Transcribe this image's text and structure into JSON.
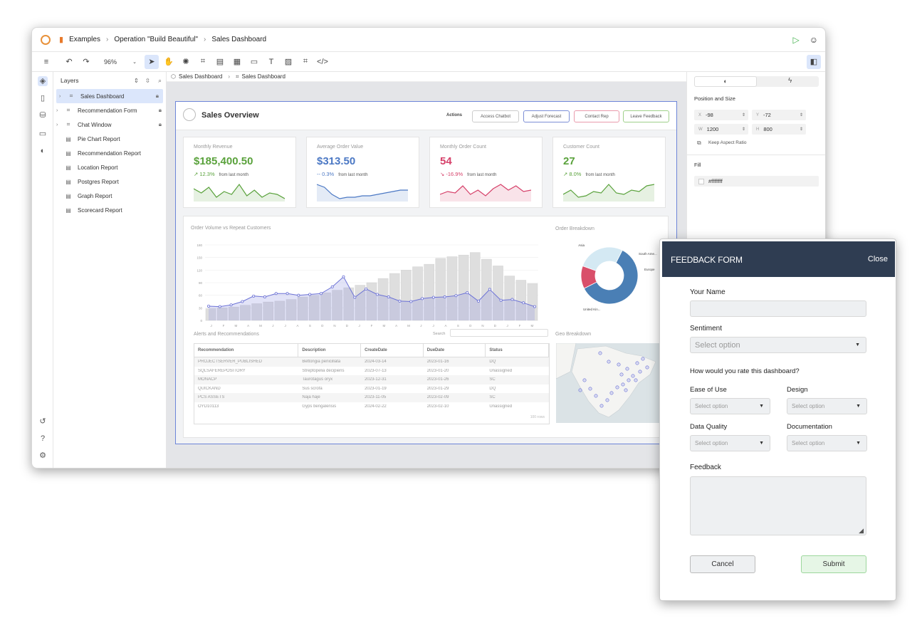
{
  "breadcrumb": {
    "examples": "Examples",
    "project": "Operation \"Build Beautiful\"",
    "page": "Sales Dashboard"
  },
  "toolbar": {
    "zoom": "96%"
  },
  "layers": {
    "title": "Layers",
    "items": [
      {
        "label": "Sales Dashboard",
        "locked": true,
        "expandable": true,
        "selected": true
      },
      {
        "label": "Recommendation Form",
        "locked": true,
        "expandable": true
      },
      {
        "label": "Chat Window",
        "locked": true,
        "expandable": true
      },
      {
        "label": "Pie Chart Report"
      },
      {
        "label": "Recommendation Report"
      },
      {
        "label": "Location Report"
      },
      {
        "label": "Postgres Report"
      },
      {
        "label": "Graph Report"
      },
      {
        "label": "Scorecard Report"
      }
    ]
  },
  "canvas_breadcrumb": {
    "a": "Sales Dashboard",
    "b": "Sales Dashboard"
  },
  "dashboard": {
    "title": "Sales Overview",
    "actions_label": "Actions",
    "actions": [
      "Access Chatbot",
      "Adjust Forecast",
      "Contact Rep",
      "Leave Feedback"
    ],
    "kpis": [
      {
        "title": "Monthly Revenue",
        "value": "$185,400.50",
        "delta": "↗ 12.3%",
        "from": "from last month",
        "color": "#5aa23c"
      },
      {
        "title": "Average Order Value",
        "value": "$313.50",
        "delta": "-- 0.3%",
        "from": "from last month",
        "color": "#4b78c4"
      },
      {
        "title": "Monthly Order Count",
        "value": "54",
        "delta": "↘ -16.9%",
        "from": "from last month",
        "color": "#d6416a"
      },
      {
        "title": "Customer Count",
        "value": "27",
        "delta": "↗ 8.0%",
        "from": "from last month",
        "color": "#5aa23c"
      }
    ],
    "order_chart_title": "Order Volume vs Repeat Customers",
    "breakdown_title": "Order Breakdown",
    "alerts_title": "Alerts and Recommendations",
    "search_label": "Search",
    "geo_title": "Geo Breakdown",
    "rows_label": "100 rows",
    "table": {
      "headers": [
        "Recommendation",
        "Description",
        "CreateDate",
        "DueDate",
        "Status"
      ],
      "rows": [
        [
          "PROJECTSERVER_PUBLISHED",
          "Bettongia penicillata",
          "2024-03-14",
          "2023-01-16",
          "DQ"
        ],
        [
          "SQLSAFEREPOSITORY",
          "Streptopelia decipiens",
          "2023-07-13",
          "2023-01-20",
          "Unassigned"
        ],
        [
          "MONACP",
          "Taurotagus oryx",
          "2023-12-31",
          "2023-01-26",
          "SC"
        ],
        [
          "QUICKAND",
          "Sus scrofa",
          "2023-01-19",
          "2023-01-29",
          "DQ"
        ],
        [
          "PCS ASSETS",
          "Naja haje",
          "2023-11-05",
          "2023-02-09",
          "SC"
        ],
        [
          "OYD10113",
          "Gyps bengalensis",
          "2024-02-22",
          "2023-02-10",
          "Unassigned"
        ]
      ]
    }
  },
  "chart_data": [
    {
      "type": "bar",
      "title": "Order Volume vs Repeat Customers",
      "categories": [
        "J",
        "F",
        "M",
        "A",
        "M",
        "J",
        "J",
        "A",
        "S",
        "O",
        "N",
        "D",
        "J",
        "F",
        "M",
        "A",
        "M",
        "J",
        "J",
        "A",
        "S",
        "O",
        "N",
        "D",
        "J",
        "F",
        "M"
      ],
      "ylim": [
        0,
        180
      ],
      "yticks": [
        "0",
        "30",
        "60",
        "90",
        "120",
        "150",
        "180"
      ],
      "series": [
        {
          "values": [
            28,
            30,
            32,
            36,
            40,
            44,
            46,
            50,
            56,
            60,
            66,
            72,
            78,
            84,
            90,
            100,
            112,
            120,
            128,
            134,
            148,
            152,
            156,
            162,
            146,
            130,
            106,
            96,
            88
          ]
        },
        {
          "values": [
            34,
            33,
            37,
            45,
            58,
            56,
            64,
            64,
            60,
            62,
            64,
            80,
            104,
            55,
            75,
            62,
            56,
            46,
            45,
            52,
            55,
            56,
            59,
            66,
            46,
            74,
            48,
            50,
            42,
            33
          ]
        }
      ]
    },
    {
      "type": "pie",
      "title": "Order Breakdown",
      "series": [
        {
          "values": [
            60,
            13,
            27
          ]
        }
      ],
      "categories": [
        "United Kin...",
        "South Ame...",
        "Asia"
      ],
      "labels_extra": [
        "Europe"
      ]
    }
  ],
  "right_panel": {
    "section": "Position and Size",
    "x": "-98",
    "y": "-72",
    "w": "1200",
    "h": "800",
    "keep_aspect": "Keep Aspect Ratio",
    "fill_title": "Fill",
    "fill_value": "#ffffffff"
  },
  "feedback": {
    "title": "FEEDBACK FORM",
    "close": "Close",
    "name_label": "Your Name",
    "sentiment_label": "Sentiment",
    "sentiment_value": "Select option",
    "rate_label": "How would you rate this dashboard?",
    "ease": "Ease of Use",
    "design": "Design",
    "dq": "Data Quality",
    "doc": "Documentation",
    "opt": "Select option",
    "feedback_label": "Feedback",
    "cancel": "Cancel",
    "submit": "Submit"
  }
}
